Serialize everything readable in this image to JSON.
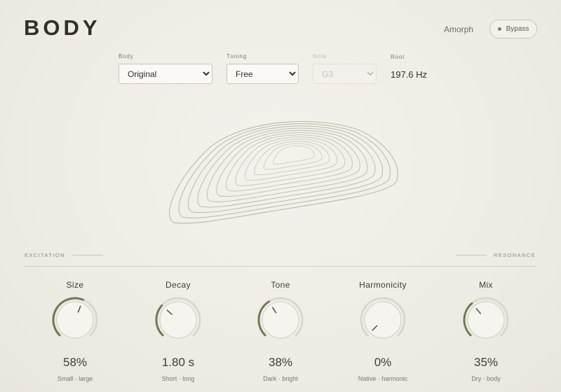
{
  "header": {
    "title": "BODY",
    "preset": "Amorph",
    "bypass_label": "Bypass"
  },
  "controls": {
    "body": {
      "label": "Body",
      "value": "Original"
    },
    "tuning": {
      "label": "Tuning",
      "value": "Free"
    },
    "note": {
      "label": "Note",
      "value": "G3",
      "disabled": true
    },
    "root": {
      "label": "Root",
      "value": "197.6 Hz"
    }
  },
  "sections": {
    "left": "EXCITATION",
    "right": "RESONANCE"
  },
  "knobs": [
    {
      "name": "Size",
      "value": "58%",
      "range": "Small · large",
      "level": 0.58
    },
    {
      "name": "Decay",
      "value": "1.80 s",
      "range": "Short · long",
      "level": 0.32
    },
    {
      "name": "Tone",
      "value": "38%",
      "range": "Dark · bright",
      "level": 0.38
    },
    {
      "name": "Harmonicity",
      "value": "0%",
      "range": "Native · harmonic",
      "level": 0.0
    },
    {
      "name": "Mix",
      "value": "35%",
      "range": "Dry · body",
      "level": 0.35
    }
  ],
  "colors": {
    "accent": "#6f7c55",
    "track": "#d9d8ce",
    "shell_stroke": "#a9ad95"
  }
}
